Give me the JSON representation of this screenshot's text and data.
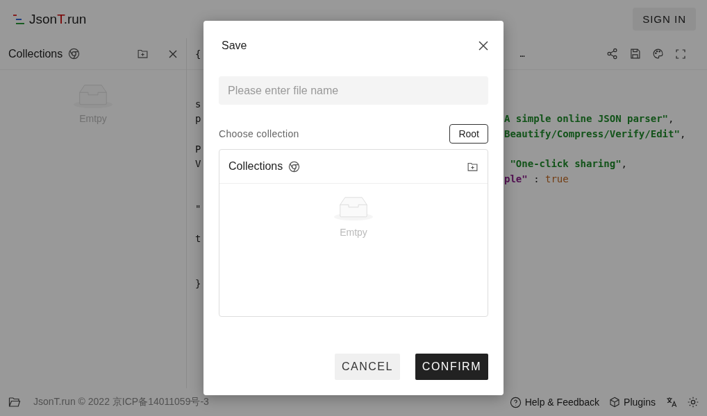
{
  "header": {
    "logo": [
      {
        "text": "Json",
        "accent": false
      },
      {
        "text": "T",
        "accent": true
      },
      {
        "text": ".run",
        "accent": false
      }
    ],
    "sign_in": "SIGN IN"
  },
  "sidebar": {
    "title": "Collections",
    "empty_text": "Emtpy"
  },
  "editor": {
    "header_left": "{",
    "header_right": "…",
    "closing": "}",
    "blocks": [
      [
        {
          "left": "s"
        },
        {
          "left": "p",
          "right": [
            {
              "text": "A simple online JSON parser\"",
              "kind": "string"
            },
            {
              "text": ",",
              "kind": "punct"
            }
          ]
        },
        {
          "right": [
            {
              "text": "Beautify/Compress/Verify/Edit\"",
              "kind": "string"
            },
            {
              "text": ",",
              "kind": "punct"
            }
          ]
        },
        {
          "left": "P"
        },
        {
          "left": "V",
          "right": [
            {
              "text": " \"One-click sharing\"",
              "kind": "string"
            },
            {
              "text": ",",
              "kind": "punct"
            }
          ]
        },
        {
          "right": [
            {
              "text": "ple\"",
              "kind": "key"
            },
            {
              "text": " : ",
              "kind": "punct"
            },
            {
              "text": "true",
              "kind": "bool"
            }
          ]
        }
      ],
      [
        {
          "left": "\""
        }
      ],
      [
        {
          "left": "t"
        }
      ]
    ]
  },
  "dialog": {
    "title": "Save",
    "placeholder": "Please enter file name",
    "choose_label": "Choose collection",
    "root_button": "Root",
    "collections_title": "Collections",
    "empty_text": "Emtpy",
    "cancel": "CANCEL",
    "confirm": "CONFIRM"
  },
  "footer": {
    "copyright": "JsonT.run © 2022 京ICP备14011059号-3",
    "help": "Help & Feedback",
    "plugins": "Plugins"
  }
}
